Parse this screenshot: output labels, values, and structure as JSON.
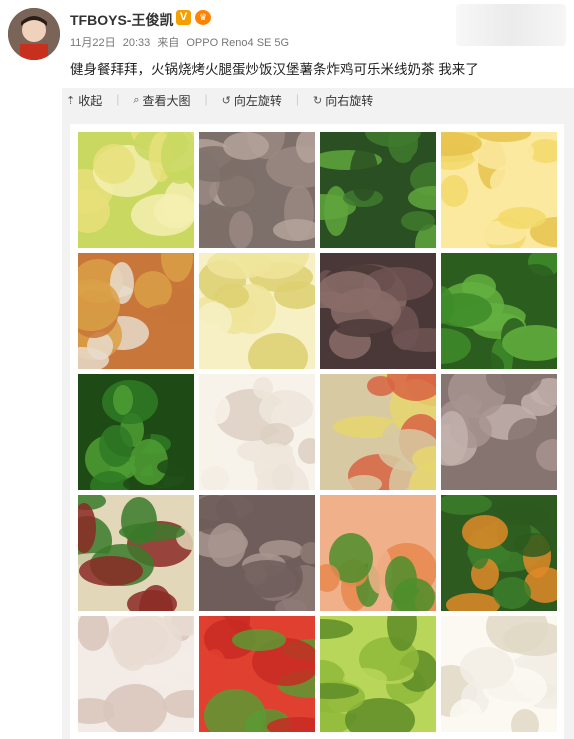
{
  "post": {
    "username": "TFBOYS-王俊凯",
    "verified_badge": "V",
    "vip_badge": "♛",
    "date": "11月22日",
    "time": "20:33",
    "source_prefix": "来自",
    "device": "OPPO Reno4 SE 5G",
    "text": "健身餐拜拜，火锅烧烤火腿蛋炒饭汉堡薯条炸鸡可乐米线奶茶 我来了"
  },
  "toolbar": {
    "collapse": "收起",
    "view_large": "查看大图",
    "rotate_left": "向左旋转",
    "rotate_right": "向右旋转"
  },
  "photos": [
    {
      "name": "napa-cabbage",
      "colors": [
        "#e8e07a",
        "#f4f0b0",
        "#c8d860"
      ]
    },
    {
      "name": "sliced-meat",
      "colors": [
        "#9a8a82",
        "#b4a39a",
        "#7d6f69"
      ]
    },
    {
      "name": "greens",
      "colors": [
        "#3f7a2e",
        "#5fa43c",
        "#2a4f22"
      ]
    },
    {
      "name": "corn",
      "colors": [
        "#f2d96a",
        "#e6c24c",
        "#fbe9a0"
      ]
    },
    {
      "name": "tofu-pumpkin",
      "colors": [
        "#e8dccb",
        "#d9a046",
        "#c8763a"
      ]
    },
    {
      "name": "cabbage",
      "colors": [
        "#eee49a",
        "#dcd070",
        "#f6f0c4"
      ]
    },
    {
      "name": "beef-chunks",
      "colors": [
        "#6e5452",
        "#8a6c68",
        "#4a3838"
      ]
    },
    {
      "name": "snow-peas",
      "colors": [
        "#3e8c2a",
        "#64b040",
        "#2b5e1e"
      ]
    },
    {
      "name": "green-pepper",
      "colors": [
        "#2f7a24",
        "#4f9e34",
        "#1e4a16"
      ]
    },
    {
      "name": "chicken-breast",
      "colors": [
        "#efe6dc",
        "#dcd0c2",
        "#f7f2ea"
      ]
    },
    {
      "name": "meal-box",
      "colors": [
        "#e6d66e",
        "#d86444",
        "#d7c9a2"
      ]
    },
    {
      "name": "pork-cubes",
      "colors": [
        "#a79490",
        "#c2b0ab",
        "#857470"
      ]
    },
    {
      "name": "spinach-dates",
      "colors": [
        "#3a7a2a",
        "#8b2a26",
        "#e2d7b8"
      ]
    },
    {
      "name": "sliced-beef",
      "colors": [
        "#8e7a76",
        "#a9958f",
        "#6e5d5a"
      ]
    },
    {
      "name": "shrimp-broccoli",
      "colors": [
        "#e8884e",
        "#4d8e2c",
        "#f0b18a"
      ]
    },
    {
      "name": "greens-pumpkin",
      "colors": [
        "#3c7e2a",
        "#e08a28",
        "#2d5a1e"
      ]
    },
    {
      "name": "shredded-chicken",
      "colors": [
        "#e9dcd2",
        "#d8c6bb",
        "#f3ece6"
      ]
    },
    {
      "name": "tomato-salad",
      "colors": [
        "#c82a22",
        "#5a9a34",
        "#e04030"
      ]
    },
    {
      "name": "broccoli",
      "colors": [
        "#8fb83a",
        "#5f8c28",
        "#b7d65a"
      ]
    },
    {
      "name": "egg-chicken",
      "colors": [
        "#f2efe6",
        "#e0d9c6",
        "#fbf9f2"
      ]
    }
  ]
}
